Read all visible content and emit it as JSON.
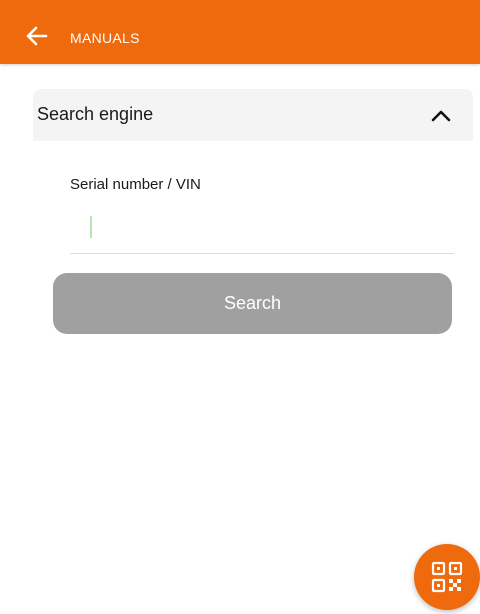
{
  "header": {
    "title": "MANUALS",
    "back_icon": "arrow-left-icon",
    "color": "#ef6a0c"
  },
  "search_engine": {
    "title": "Search engine",
    "expanded": true,
    "toggle_icon": "chevron-up-icon",
    "serial_label": "Serial number / VIN",
    "serial_value": "",
    "search_label": "Search",
    "search_button_color": "#a0a0a0"
  },
  "fab": {
    "icon": "qr-code-icon"
  }
}
